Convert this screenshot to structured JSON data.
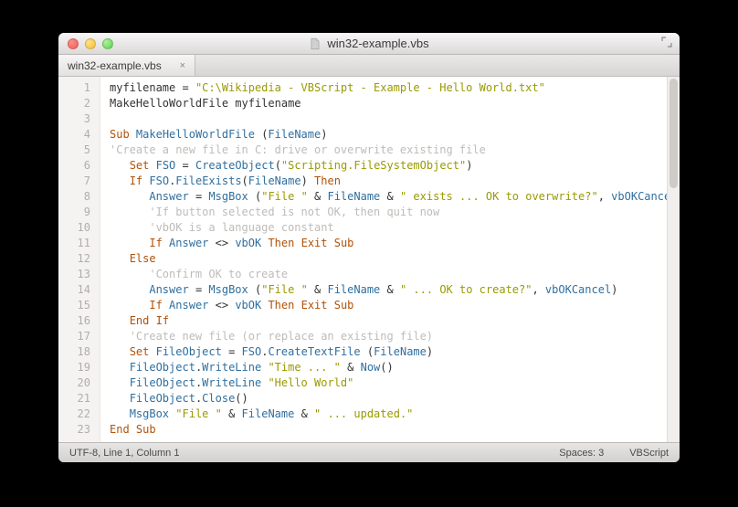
{
  "window": {
    "title": "win32-example.vbs"
  },
  "tab": {
    "label": "win32-example.vbs",
    "close": "×"
  },
  "status": {
    "left": "UTF-8, Line 1, Column 1",
    "spaces": "Spaces: 3",
    "lang": "VBScript"
  },
  "code": {
    "lines": [
      {
        "n": 1,
        "segs": [
          {
            "t": "myfilename",
            "c": "ident"
          },
          {
            "t": " = ",
            "c": "ident"
          },
          {
            "t": "\"C:\\Wikipedia - VBScript - Example - Hello World.txt\"",
            "c": "str"
          }
        ]
      },
      {
        "n": 2,
        "segs": [
          {
            "t": "MakeHelloWorldFile myfilename",
            "c": "ident"
          }
        ]
      },
      {
        "n": 3,
        "segs": []
      },
      {
        "n": 4,
        "segs": [
          {
            "t": "Sub",
            "c": "kw"
          },
          {
            "t": " ",
            "c": "ident"
          },
          {
            "t": "MakeHelloWorldFile",
            "c": "fn"
          },
          {
            "t": " (",
            "c": "ident"
          },
          {
            "t": "FileName",
            "c": "fn"
          },
          {
            "t": ")",
            "c": "ident"
          }
        ]
      },
      {
        "n": 5,
        "segs": [
          {
            "t": "'Create a new file in C: drive or overwrite existing file",
            "c": "cmt"
          }
        ]
      },
      {
        "n": 6,
        "segs": [
          {
            "t": "   ",
            "c": "ident"
          },
          {
            "t": "Set",
            "c": "kw"
          },
          {
            "t": " ",
            "c": "ident"
          },
          {
            "t": "FSO",
            "c": "fn"
          },
          {
            "t": " = ",
            "c": "ident"
          },
          {
            "t": "CreateObject",
            "c": "fn"
          },
          {
            "t": "(",
            "c": "ident"
          },
          {
            "t": "\"Scripting.FileSystemObject\"",
            "c": "str"
          },
          {
            "t": ")",
            "c": "ident"
          }
        ]
      },
      {
        "n": 7,
        "segs": [
          {
            "t": "   ",
            "c": "ident"
          },
          {
            "t": "If",
            "c": "kw"
          },
          {
            "t": " ",
            "c": "ident"
          },
          {
            "t": "FSO",
            "c": "fn"
          },
          {
            "t": ".",
            "c": "ident"
          },
          {
            "t": "FileExists",
            "c": "fn"
          },
          {
            "t": "(",
            "c": "ident"
          },
          {
            "t": "FileName",
            "c": "fn"
          },
          {
            "t": ") ",
            "c": "ident"
          },
          {
            "t": "Then",
            "c": "kw"
          }
        ]
      },
      {
        "n": 8,
        "segs": [
          {
            "t": "      ",
            "c": "ident"
          },
          {
            "t": "Answer",
            "c": "fn"
          },
          {
            "t": " = ",
            "c": "ident"
          },
          {
            "t": "MsgBox",
            "c": "fn"
          },
          {
            "t": " (",
            "c": "ident"
          },
          {
            "t": "\"File \"",
            "c": "str"
          },
          {
            "t": " & ",
            "c": "ident"
          },
          {
            "t": "FileName",
            "c": "fn"
          },
          {
            "t": " & ",
            "c": "ident"
          },
          {
            "t": "\" exists ... OK to overwrite?\"",
            "c": "str"
          },
          {
            "t": ", ",
            "c": "ident"
          },
          {
            "t": "vbOKCancel",
            "c": "fn"
          },
          {
            "t": ")",
            "c": "ident"
          }
        ]
      },
      {
        "n": 9,
        "segs": [
          {
            "t": "      ",
            "c": "ident"
          },
          {
            "t": "'If button selected is not OK, then quit now",
            "c": "cmt"
          }
        ]
      },
      {
        "n": 10,
        "segs": [
          {
            "t": "      ",
            "c": "ident"
          },
          {
            "t": "'vbOK is a language constant",
            "c": "cmt"
          }
        ]
      },
      {
        "n": 11,
        "segs": [
          {
            "t": "      ",
            "c": "ident"
          },
          {
            "t": "If",
            "c": "kw"
          },
          {
            "t": " ",
            "c": "ident"
          },
          {
            "t": "Answer",
            "c": "fn"
          },
          {
            "t": " <> ",
            "c": "ident"
          },
          {
            "t": "vbOK",
            "c": "fn"
          },
          {
            "t": " ",
            "c": "ident"
          },
          {
            "t": "Then",
            "c": "kw"
          },
          {
            "t": " ",
            "c": "ident"
          },
          {
            "t": "Exit",
            "c": "kw"
          },
          {
            "t": " ",
            "c": "ident"
          },
          {
            "t": "Sub",
            "c": "kw"
          }
        ]
      },
      {
        "n": 12,
        "segs": [
          {
            "t": "   ",
            "c": "ident"
          },
          {
            "t": "Else",
            "c": "kw"
          }
        ]
      },
      {
        "n": 13,
        "segs": [
          {
            "t": "      ",
            "c": "ident"
          },
          {
            "t": "'Confirm OK to create",
            "c": "cmt"
          }
        ]
      },
      {
        "n": 14,
        "segs": [
          {
            "t": "      ",
            "c": "ident"
          },
          {
            "t": "Answer",
            "c": "fn"
          },
          {
            "t": " = ",
            "c": "ident"
          },
          {
            "t": "MsgBox",
            "c": "fn"
          },
          {
            "t": " (",
            "c": "ident"
          },
          {
            "t": "\"File \"",
            "c": "str"
          },
          {
            "t": " & ",
            "c": "ident"
          },
          {
            "t": "FileName",
            "c": "fn"
          },
          {
            "t": " & ",
            "c": "ident"
          },
          {
            "t": "\" ... OK to create?\"",
            "c": "str"
          },
          {
            "t": ", ",
            "c": "ident"
          },
          {
            "t": "vbOKCancel",
            "c": "fn"
          },
          {
            "t": ")",
            "c": "ident"
          }
        ]
      },
      {
        "n": 15,
        "segs": [
          {
            "t": "      ",
            "c": "ident"
          },
          {
            "t": "If",
            "c": "kw"
          },
          {
            "t": " ",
            "c": "ident"
          },
          {
            "t": "Answer",
            "c": "fn"
          },
          {
            "t": " <> ",
            "c": "ident"
          },
          {
            "t": "vbOK",
            "c": "fn"
          },
          {
            "t": " ",
            "c": "ident"
          },
          {
            "t": "Then",
            "c": "kw"
          },
          {
            "t": " ",
            "c": "ident"
          },
          {
            "t": "Exit",
            "c": "kw"
          },
          {
            "t": " ",
            "c": "ident"
          },
          {
            "t": "Sub",
            "c": "kw"
          }
        ]
      },
      {
        "n": 16,
        "segs": [
          {
            "t": "   ",
            "c": "ident"
          },
          {
            "t": "End",
            "c": "kw"
          },
          {
            "t": " ",
            "c": "ident"
          },
          {
            "t": "If",
            "c": "kw"
          }
        ]
      },
      {
        "n": 17,
        "segs": [
          {
            "t": "   ",
            "c": "ident"
          },
          {
            "t": "'Create new file (or replace an existing file)",
            "c": "cmt"
          }
        ]
      },
      {
        "n": 18,
        "segs": [
          {
            "t": "   ",
            "c": "ident"
          },
          {
            "t": "Set",
            "c": "kw"
          },
          {
            "t": " ",
            "c": "ident"
          },
          {
            "t": "FileObject",
            "c": "fn"
          },
          {
            "t": " = ",
            "c": "ident"
          },
          {
            "t": "FSO",
            "c": "fn"
          },
          {
            "t": ".",
            "c": "ident"
          },
          {
            "t": "CreateTextFile",
            "c": "fn"
          },
          {
            "t": " (",
            "c": "ident"
          },
          {
            "t": "FileName",
            "c": "fn"
          },
          {
            "t": ")",
            "c": "ident"
          }
        ]
      },
      {
        "n": 19,
        "segs": [
          {
            "t": "   ",
            "c": "ident"
          },
          {
            "t": "FileObject",
            "c": "fn"
          },
          {
            "t": ".",
            "c": "ident"
          },
          {
            "t": "WriteLine",
            "c": "fn"
          },
          {
            "t": " ",
            "c": "ident"
          },
          {
            "t": "\"Time ... \"",
            "c": "str"
          },
          {
            "t": " & ",
            "c": "ident"
          },
          {
            "t": "Now",
            "c": "fn"
          },
          {
            "t": "()",
            "c": "ident"
          }
        ]
      },
      {
        "n": 20,
        "segs": [
          {
            "t": "   ",
            "c": "ident"
          },
          {
            "t": "FileObject",
            "c": "fn"
          },
          {
            "t": ".",
            "c": "ident"
          },
          {
            "t": "WriteLine",
            "c": "fn"
          },
          {
            "t": " ",
            "c": "ident"
          },
          {
            "t": "\"Hello World\"",
            "c": "str"
          }
        ]
      },
      {
        "n": 21,
        "segs": [
          {
            "t": "   ",
            "c": "ident"
          },
          {
            "t": "FileObject",
            "c": "fn"
          },
          {
            "t": ".",
            "c": "ident"
          },
          {
            "t": "Close",
            "c": "fn"
          },
          {
            "t": "()",
            "c": "ident"
          }
        ]
      },
      {
        "n": 22,
        "segs": [
          {
            "t": "   ",
            "c": "ident"
          },
          {
            "t": "MsgBox",
            "c": "fn"
          },
          {
            "t": " ",
            "c": "ident"
          },
          {
            "t": "\"File \"",
            "c": "str"
          },
          {
            "t": " & ",
            "c": "ident"
          },
          {
            "t": "FileName",
            "c": "fn"
          },
          {
            "t": " & ",
            "c": "ident"
          },
          {
            "t": "\" ... updated.\"",
            "c": "str"
          }
        ]
      },
      {
        "n": 23,
        "segs": [
          {
            "t": "End",
            "c": "kw"
          },
          {
            "t": " ",
            "c": "ident"
          },
          {
            "t": "Sub",
            "c": "kw"
          }
        ]
      }
    ]
  }
}
